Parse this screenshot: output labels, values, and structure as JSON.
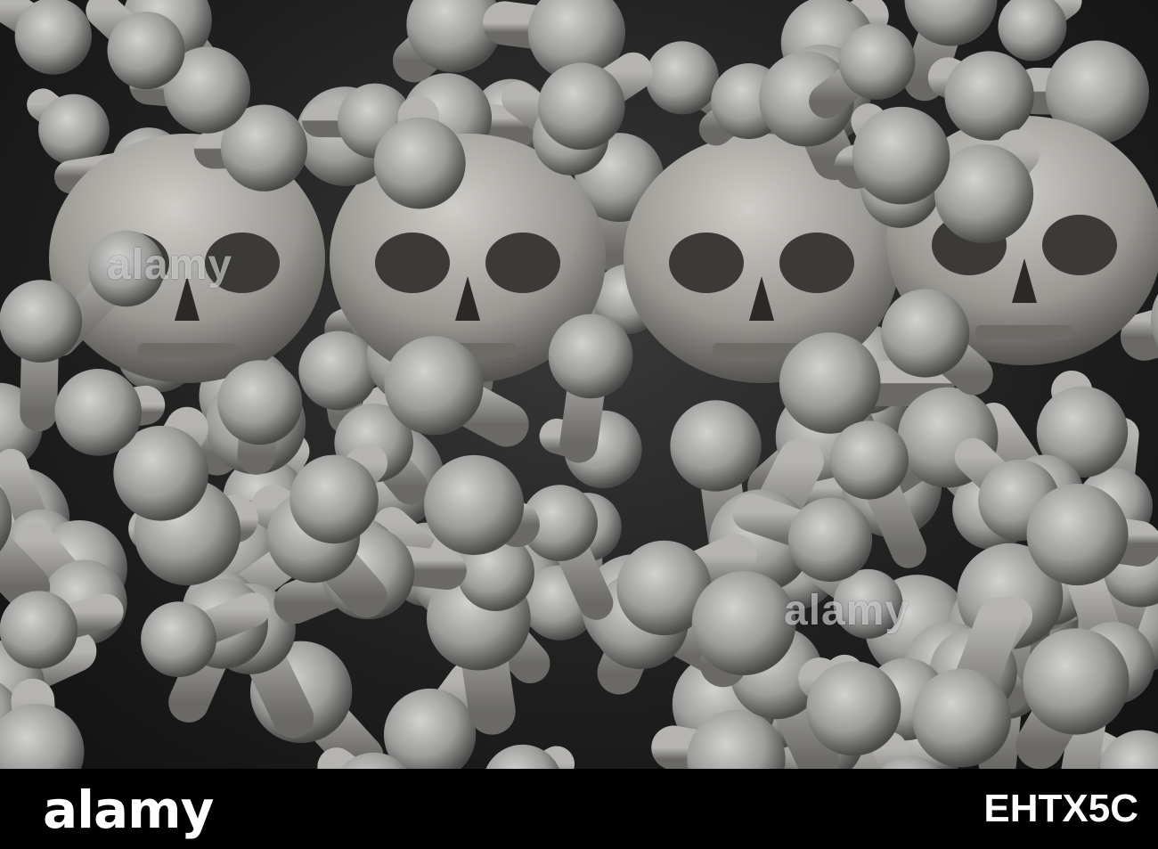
{
  "photo": {
    "subject": "",
    "watermark_text": "alamy"
  },
  "footer": {
    "logo_text": "alamy",
    "image_id": "EHTX5C",
    "background": "#000000",
    "text_color": "#ffffff"
  }
}
